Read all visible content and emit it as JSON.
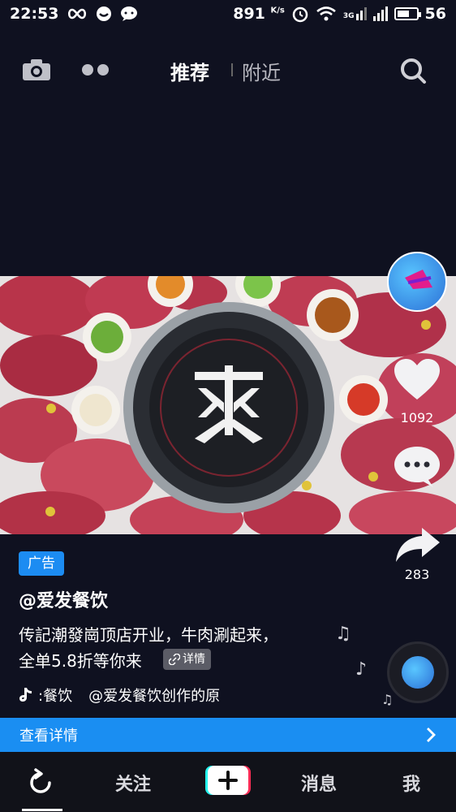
{
  "status_bar": {
    "time": "22:53",
    "speed": "891",
    "speed_unit": "K/s",
    "battery": "56",
    "signal_label": "3G"
  },
  "top_nav": {
    "tab_recommend": "推荐",
    "tab_nearby": "附近"
  },
  "right_rail": {
    "like_count": "1092",
    "share_count": "283"
  },
  "ad": {
    "badge": "广告",
    "account": "@爱发餐饮",
    "desc_line1": "传記潮發崗顶店开业，牛肉涮起来，",
    "desc_line2": "全单5.8折等你来",
    "detail_chip": "详情",
    "music_prefix": ":餐饮",
    "music_text": "@爱发餐饮创作的原"
  },
  "cta": {
    "label": "查看详情"
  },
  "bottom_nav": {
    "follow": "关注",
    "messages": "消息",
    "me": "我"
  },
  "colors": {
    "background": "#0f1120",
    "accent_blue": "#1a8ef2",
    "plus_pink": "#fe2c55",
    "plus_cyan": "#25f4ee"
  }
}
